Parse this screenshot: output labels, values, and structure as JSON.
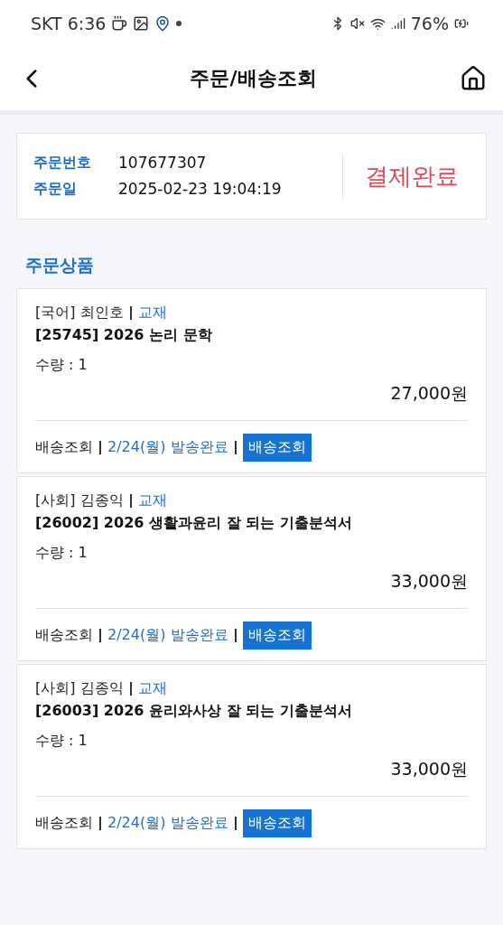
{
  "status_bar": {
    "carrier": "SKT",
    "time": "6:36",
    "battery": "76%"
  },
  "header": {
    "title": "주문/배송조회"
  },
  "order": {
    "number_label": "주문번호",
    "number": "107677307",
    "date_label": "주문일",
    "date": "2025-02-23 19:04:19",
    "status": "결제완료"
  },
  "section_title": "주문상품",
  "items": [
    {
      "category": "[국어] 최인호",
      "type": "교재",
      "name": "[25745] 2026 논리 문학",
      "quantity": "수량 : 1",
      "price": "27,000원",
      "delivery_label": "배송조회",
      "delivery_status": "2/24(월) 발송완료",
      "track_button": "배송조회"
    },
    {
      "category": "[사회] 김종익",
      "type": "교재",
      "name": "[26002] 2026 생활과윤리 잘 되는 기출분석서",
      "quantity": "수량 : 1",
      "price": "33,000원",
      "delivery_label": "배송조회",
      "delivery_status": "2/24(월) 발송완료",
      "track_button": "배송조회"
    },
    {
      "category": "[사회] 김종익",
      "type": "교재",
      "name": "[26003] 2026 윤리와사상 잘 되는 기출분석서",
      "quantity": "수량 : 1",
      "price": "33,000원",
      "delivery_label": "배송조회",
      "delivery_status": "2/24(월) 발송완료",
      "track_button": "배송조회"
    }
  ]
}
